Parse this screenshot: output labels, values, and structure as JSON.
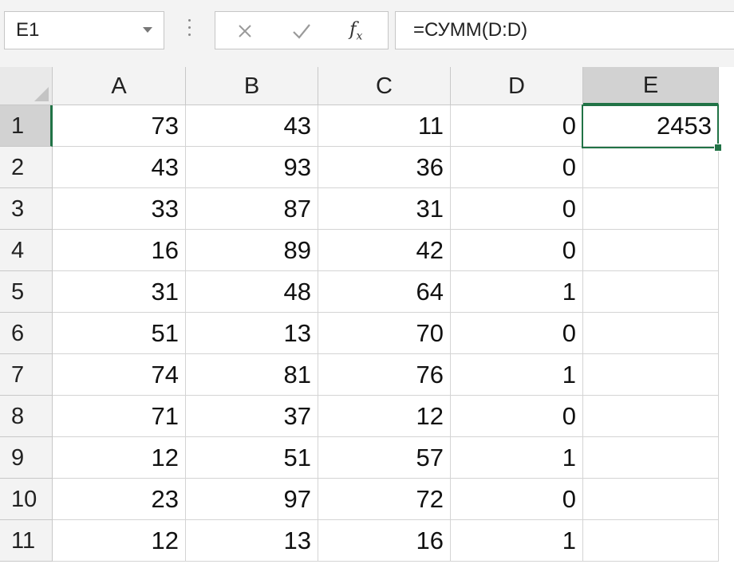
{
  "name_box": {
    "value": "E1"
  },
  "formula_bar": {
    "cancel_icon": "close-x-icon",
    "enter_icon": "check-icon",
    "fx_label": "fx",
    "formula": "=СУММ(D:D)"
  },
  "accent_color": "#217346",
  "selected_cell": "E1",
  "columns": [
    "A",
    "B",
    "C",
    "D",
    "E"
  ],
  "rows": [
    {
      "num": "1",
      "cells": [
        "73",
        "43",
        "11",
        "0",
        "2453"
      ]
    },
    {
      "num": "2",
      "cells": [
        "43",
        "93",
        "36",
        "0",
        ""
      ]
    },
    {
      "num": "3",
      "cells": [
        "33",
        "87",
        "31",
        "0",
        ""
      ]
    },
    {
      "num": "4",
      "cells": [
        "16",
        "89",
        "42",
        "0",
        ""
      ]
    },
    {
      "num": "5",
      "cells": [
        "31",
        "48",
        "64",
        "1",
        ""
      ]
    },
    {
      "num": "6",
      "cells": [
        "51",
        "13",
        "70",
        "0",
        ""
      ]
    },
    {
      "num": "7",
      "cells": [
        "74",
        "81",
        "76",
        "1",
        ""
      ]
    },
    {
      "num": "8",
      "cells": [
        "71",
        "37",
        "12",
        "0",
        ""
      ]
    },
    {
      "num": "9",
      "cells": [
        "12",
        "51",
        "57",
        "1",
        ""
      ]
    },
    {
      "num": "10",
      "cells": [
        "23",
        "97",
        "72",
        "0",
        ""
      ]
    },
    {
      "num": "11",
      "cells": [
        "12",
        "13",
        "16",
        "1",
        ""
      ]
    }
  ]
}
